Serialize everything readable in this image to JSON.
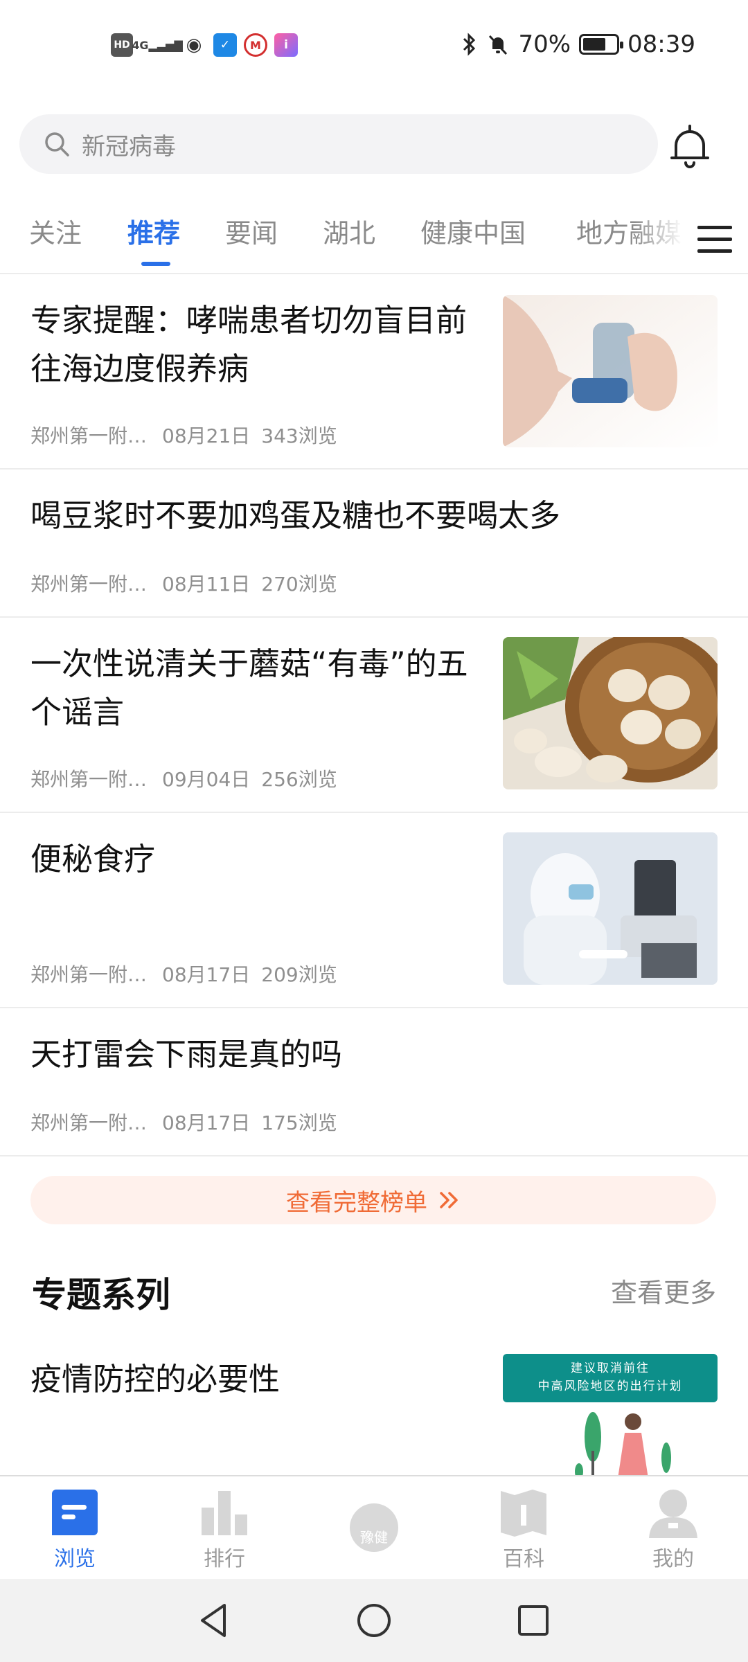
{
  "status_bar": {
    "left_icons": [
      "HD",
      "4G",
      "weibo",
      "app-blue",
      "app-metro",
      "app-colorful"
    ],
    "battery": "70%",
    "battery_level": 0.7,
    "time": "08:39"
  },
  "search": {
    "placeholder": "新冠病毒"
  },
  "tabs": [
    {
      "label": "关注",
      "active": false
    },
    {
      "label": "推荐",
      "active": true
    },
    {
      "label": "要闻",
      "active": false
    },
    {
      "label": "湖北",
      "active": false
    },
    {
      "label": "健康中国",
      "active": false
    },
    {
      "label": "地方融媒",
      "active": false
    }
  ],
  "news": [
    {
      "title": "专家提醒：哮喘患者切勿盲目前往海边度假养病",
      "source": "郑州第一附…",
      "date": "08月21日",
      "views": "343浏览",
      "image": "asthma-inhaler"
    },
    {
      "title": "喝豆浆时不要加鸡蛋及糖也不要喝太多",
      "source": "郑州第一附…",
      "date": "08月11日",
      "views": "270浏览",
      "image": ""
    },
    {
      "title": "一次性说清关于蘑菇“有毒”的五个谣言",
      "source": "郑州第一附…",
      "date": "09月04日",
      "views": "256浏览",
      "image": "mushrooms-basket"
    },
    {
      "title": "便秘食疗",
      "source": "郑州第一附…",
      "date": "08月17日",
      "views": "209浏览",
      "image": "lab-microscope"
    },
    {
      "title": "天打雷会下雨是真的吗",
      "source": "郑州第一附…",
      "date": "08月17日",
      "views": "175浏览",
      "image": ""
    }
  ],
  "full_list_button": "查看完整榜单",
  "topics": {
    "title": "专题系列",
    "more": "查看更多",
    "item": {
      "title": "疫情防控的必要性",
      "banner_line1": "建议取消前往",
      "banner_line2": "中高风险地区的出行计划"
    }
  },
  "bottom_nav": [
    {
      "label": "浏览",
      "icon": "browse-icon",
      "active": true
    },
    {
      "label": "排行",
      "icon": "ranking-icon",
      "active": false
    },
    {
      "label": "豫健",
      "icon": "center-logo-icon",
      "active": false
    },
    {
      "label": "百科",
      "icon": "encyclopedia-icon",
      "active": false
    },
    {
      "label": "我的",
      "icon": "profile-icon",
      "active": false
    }
  ],
  "colors": {
    "accent": "#2a70e8",
    "orange": "#f06b36",
    "muted": "#8f8f8f"
  }
}
